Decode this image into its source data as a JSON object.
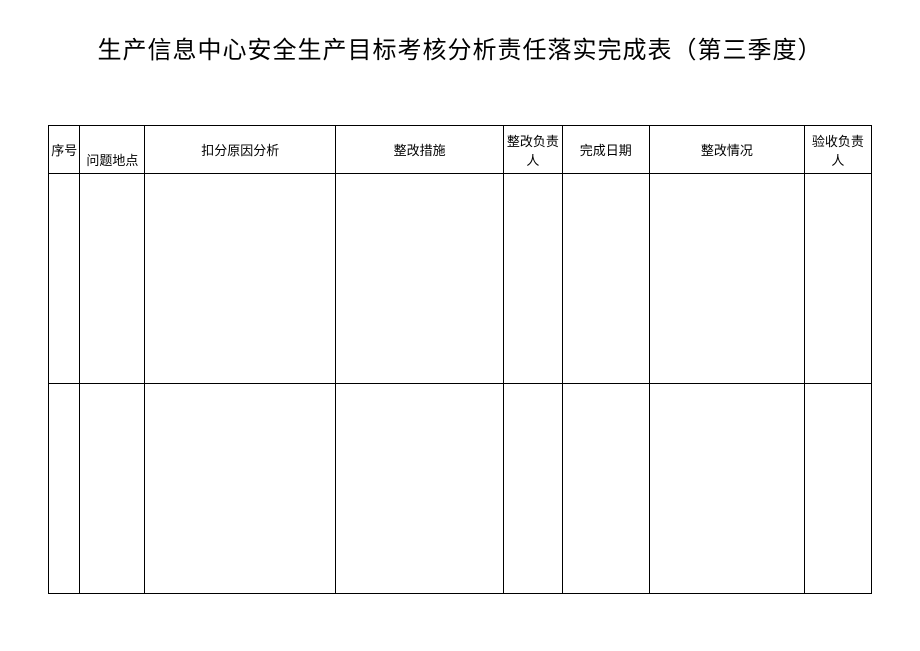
{
  "title": "生产信息中心安全生产目标考核分析责任落实完成表（第三季度）",
  "headers": {
    "seq": "序号",
    "location": "问题地点",
    "reason": "扣分原因分析",
    "measure": "整改措施",
    "person": "整改负责人",
    "date": "完成日期",
    "status": "整改情况",
    "acceptor": "验收负责人"
  },
  "rows": [
    {
      "seq": "",
      "location": "",
      "reason": "",
      "measure": "",
      "person": "",
      "date": "",
      "status": "",
      "acceptor": ""
    },
    {
      "seq": "",
      "location": "",
      "reason": "",
      "measure": "",
      "person": "",
      "date": "",
      "status": "",
      "acceptor": ""
    }
  ]
}
